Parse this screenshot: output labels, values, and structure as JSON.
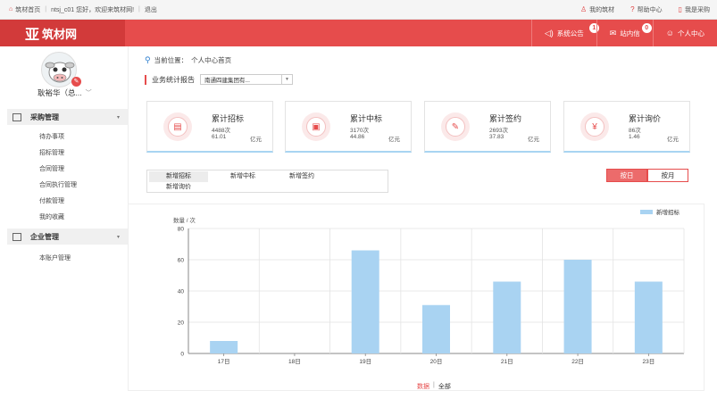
{
  "topbar": {
    "home": "筑材首页",
    "greeting": "ntsj_c01 您好，欢迎来筑材网!",
    "logout": "退出",
    "my_account": "我的筑材",
    "help": "帮助中心",
    "buyer": "我是采购"
  },
  "header": {
    "logo_text": "筑材网",
    "announcement": "系统公告",
    "announcement_count": "1",
    "messages": "站内信",
    "messages_count": "0",
    "personal_center": "个人中心"
  },
  "sidebar": {
    "username": "耿裕华（总...",
    "section1": "采购管理",
    "section1_items": [
      "待办事项",
      "招标管理",
      "合同管理",
      "合同执行管理",
      "付款管理",
      "我的收藏"
    ],
    "section2": "企业管理",
    "section2_items": [
      "本账户管理"
    ]
  },
  "breadcrumb": {
    "label": "当前位置：",
    "current": "个人中心首页"
  },
  "report": {
    "title": "业务统计报告",
    "company": "南通四建集团有..."
  },
  "cards": [
    {
      "title": "累计招标",
      "count": "4488次",
      "amount": "61.01",
      "unit": "亿元",
      "icon": "document-icon"
    },
    {
      "title": "累计中标",
      "count": "3170次",
      "amount": "44.86",
      "unit": "亿元",
      "icon": "award-doc-icon"
    },
    {
      "title": "累计签约",
      "count": "2693次",
      "amount": "37.83",
      "unit": "亿元",
      "icon": "edit-icon"
    },
    {
      "title": "累计询价",
      "count": "86次",
      "amount": "1.46",
      "unit": "亿元",
      "icon": "yuan-icon"
    }
  ],
  "tabs": [
    "新增招标",
    "新增中标",
    "新增签约",
    "新增询价"
  ],
  "period": {
    "day": "按日",
    "month": "按月"
  },
  "chart_footer": {
    "data": "数据",
    "all": "全部"
  },
  "colors": {
    "brand_red": "#e64c4c",
    "bar_blue": "#a9d3f2"
  },
  "chart_data": {
    "type": "bar",
    "categories": [
      "17日",
      "18日",
      "19日",
      "20日",
      "21日",
      "22日",
      "23日"
    ],
    "series": [
      {
        "name": "新增招标",
        "values": [
          8,
          0,
          66,
          31,
          46,
          60,
          46
        ]
      }
    ],
    "ylabel": "数量 / 次",
    "ylim": [
      0,
      80
    ],
    "yticks": [
      0,
      20,
      40,
      60,
      80
    ],
    "grid": true,
    "legend": "top-right"
  }
}
